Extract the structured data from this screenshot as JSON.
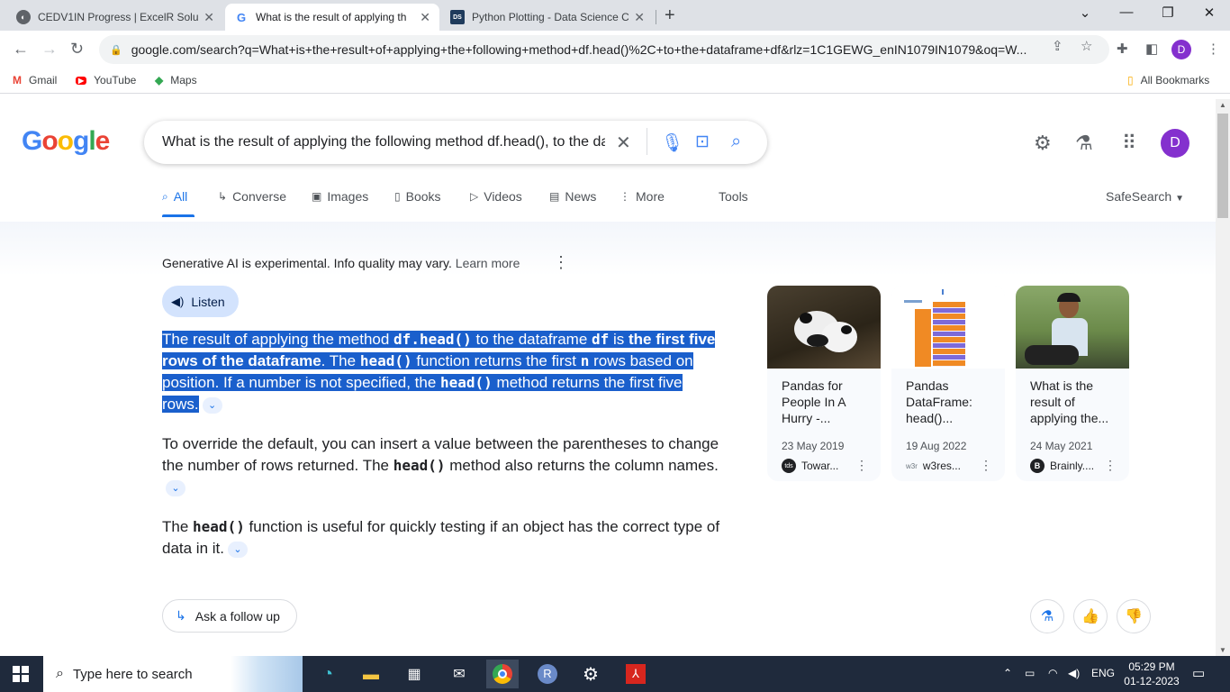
{
  "browser": {
    "tabs": [
      {
        "title": "CEDV1IN Progress | ExcelR Solut",
        "icon": "excelr-icon",
        "active": false
      },
      {
        "title": "What is the result of applying th",
        "icon": "google-g-icon",
        "active": true
      },
      {
        "title": "Python Plotting - Data Science C",
        "icon": "datasci-icon",
        "active": false
      }
    ],
    "url": "google.com/search?q=What+is+the+result+of+applying+the+following+method+df.head()%2C+to+the+dataframe+df&rlz=1C1GEWG_enIN1079IN1079&oq=W...",
    "profile_initial": "D",
    "bookmarks": [
      {
        "label": "Gmail",
        "icon": "gmail-icon"
      },
      {
        "label": "YouTube",
        "icon": "youtube-icon"
      },
      {
        "label": "Maps",
        "icon": "maps-icon"
      }
    ],
    "all_bookmarks": "All Bookmarks"
  },
  "google": {
    "logo": "Google",
    "query": "What is the result of applying the following method df.head(), to the dataframe df",
    "avatar_initial": "D",
    "tabs": [
      "All",
      "Converse",
      "Images",
      "Books",
      "Videos",
      "News",
      "More"
    ],
    "tools": "Tools",
    "safesearch": "SafeSearch"
  },
  "ai": {
    "disclaimer": "Generative AI is experimental. Info quality may vary.",
    "learn_more": "Learn more",
    "listen": "Listen",
    "p1": {
      "t1": "The result of applying the method ",
      "c1": "df.head()",
      "t2": " to the dataframe ",
      "c2": "df",
      "t3": " is ",
      "b1": "the first five rows of the dataframe",
      "t4": ". The ",
      "c3": "head()",
      "t5": " function returns the first ",
      "c4": "n",
      "t6": " rows based on position. If a number is not specified, the ",
      "c5": "head()",
      "t7": " method returns the first five rows."
    },
    "p2": {
      "t1": "To override the default, you can insert a value between the parentheses to change the number of rows returned. The ",
      "c1": "head()",
      "t2": " method also returns the column names."
    },
    "p3": {
      "t1": "The ",
      "c1": "head()",
      "t2": " function is useful for quickly testing if an object has the correct type of data in it."
    },
    "ask_follow_up": "Ask a follow up"
  },
  "cards": [
    {
      "title": "Pandas for People In A Hurry -...",
      "date": "23 May 2019",
      "source": "Towar...",
      "source_icon": "tds"
    },
    {
      "title": "Pandas DataFrame: head()...",
      "date": "19 Aug 2022",
      "source": "w3res...",
      "source_icon": "w3r"
    },
    {
      "title": "What is the result of applying the...",
      "date": "24 May 2021",
      "source": "Brainly....",
      "source_icon": "B"
    }
  ],
  "taskbar": {
    "search_placeholder": "Type here to search",
    "language": "ENG",
    "time": "05:29 PM",
    "date": "01-12-2023"
  }
}
